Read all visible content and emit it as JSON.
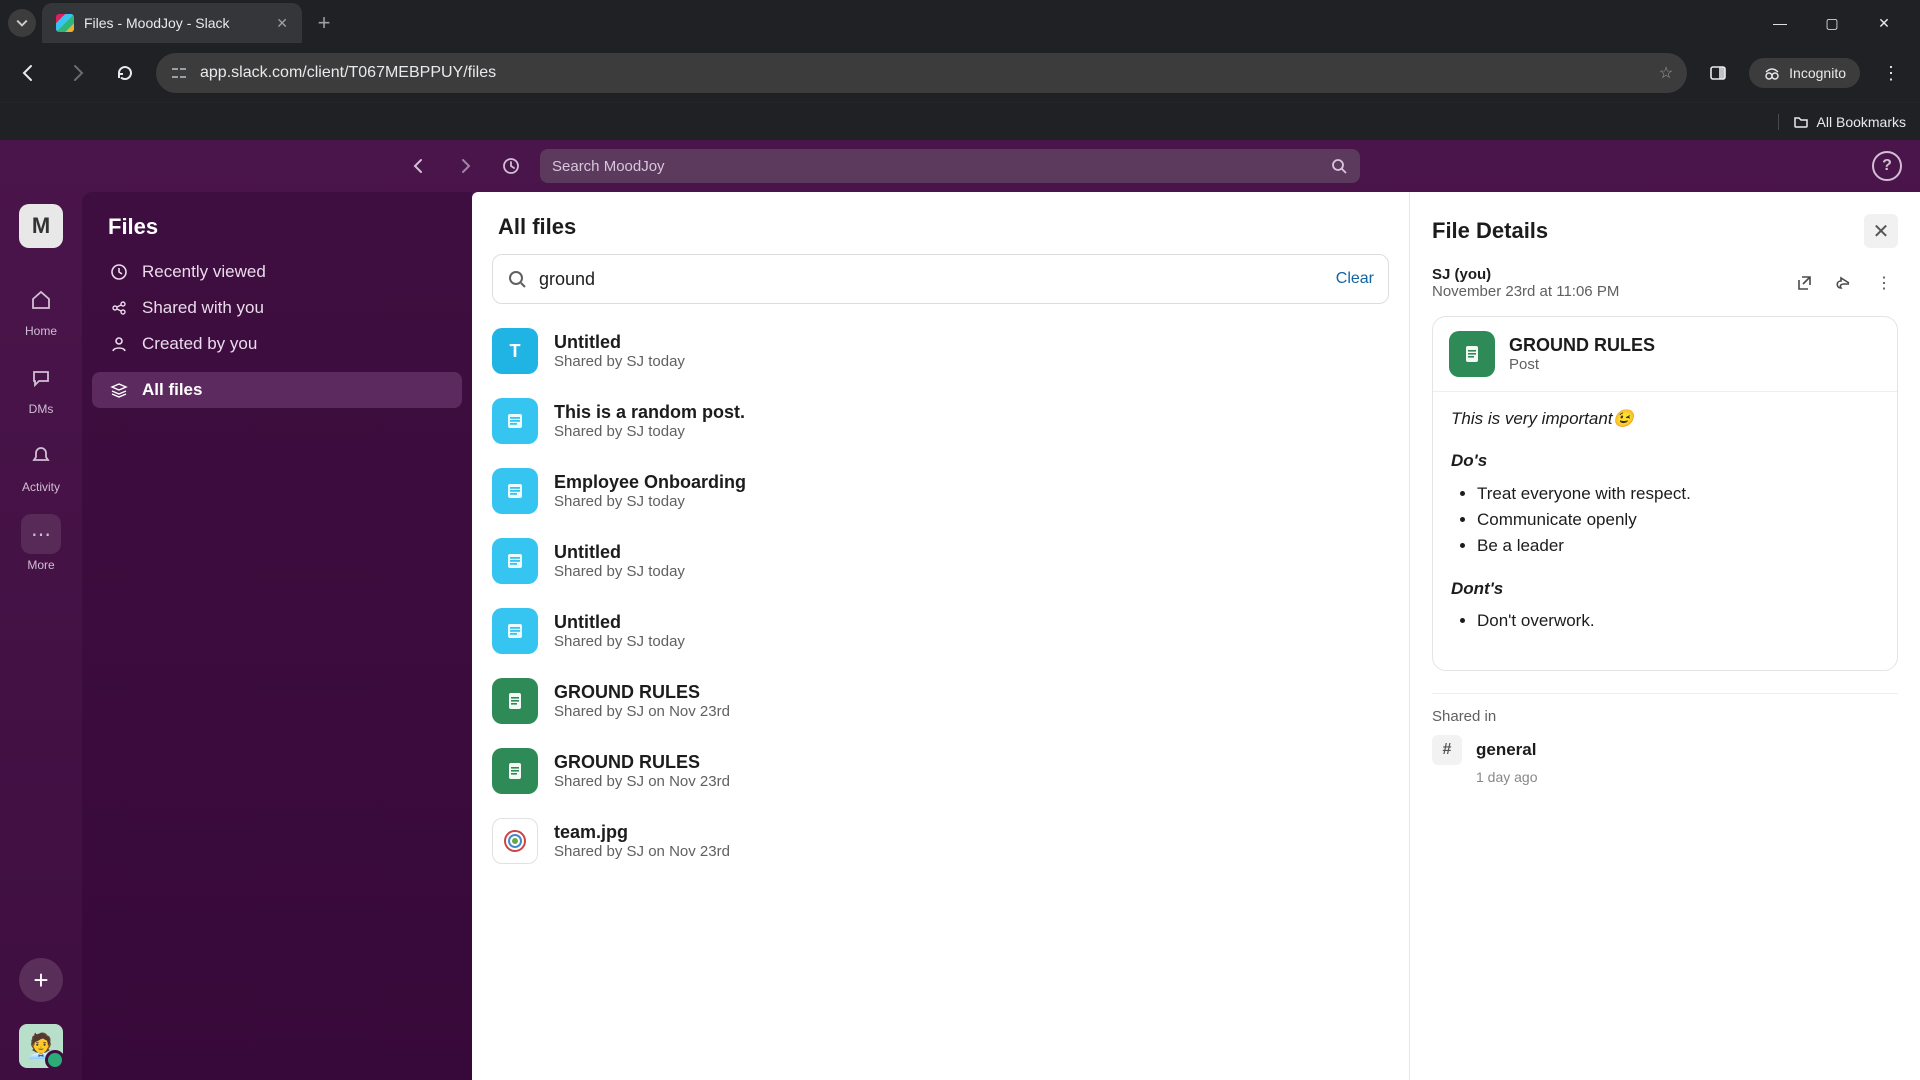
{
  "browser": {
    "tab_title": "Files - MoodJoy - Slack",
    "url": "app.slack.com/client/T067MEBPPUY/files",
    "new_tab_tooltip": "+",
    "incognito_label": "Incognito",
    "all_bookmarks": "All Bookmarks"
  },
  "slack": {
    "search_placeholder": "Search MoodJoy",
    "help_glyph": "?",
    "workspace_initial": "M",
    "rail": [
      {
        "id": "home",
        "label": "Home"
      },
      {
        "id": "dms",
        "label": "DMs"
      },
      {
        "id": "activity",
        "label": "Activity"
      },
      {
        "id": "more",
        "label": "More"
      }
    ],
    "add_label": "+"
  },
  "sidebar": {
    "title": "Files",
    "items": [
      {
        "icon": "clock",
        "label": "Recently viewed"
      },
      {
        "icon": "share",
        "label": "Shared with you"
      },
      {
        "icon": "person",
        "label": "Created by you"
      },
      {
        "icon": "stack",
        "label": "All files",
        "active": true
      }
    ]
  },
  "files": {
    "title": "All files",
    "search_value": "ground",
    "clear_label": "Clear",
    "items": [
      {
        "kind": "text",
        "title": "Untitled",
        "sub": "Shared by SJ today"
      },
      {
        "kind": "post",
        "title": "This is a random post.",
        "sub": "Shared by SJ today"
      },
      {
        "kind": "post",
        "title": "Employee Onboarding",
        "sub": "Shared by SJ today"
      },
      {
        "kind": "post",
        "title": "Untitled",
        "sub": "Shared by SJ today"
      },
      {
        "kind": "post",
        "title": "Untitled",
        "sub": "Shared by SJ today"
      },
      {
        "kind": "doc",
        "title": "GROUND RULES",
        "sub": "Shared by SJ on Nov 23rd"
      },
      {
        "kind": "doc",
        "title": "GROUND RULES",
        "sub": "Shared by SJ on Nov 23rd"
      },
      {
        "kind": "img",
        "title": "team.jpg",
        "sub": "Shared by SJ on Nov 23rd"
      }
    ]
  },
  "details": {
    "title": "File Details",
    "author": "SJ (you)",
    "when": "November 23rd at 11:06 PM",
    "doc_title": "GROUND RULES",
    "doc_type": "Post",
    "body_intro": "This is very important😉",
    "dos_header": "Do's",
    "dos": [
      "Treat everyone with respect.",
      "Communicate openly",
      "Be a leader"
    ],
    "donts_header": "Dont's",
    "donts": [
      "Don't overwork."
    ],
    "shared_in_label": "Shared in",
    "channel_name": "general",
    "channel_ago": "1 day ago"
  }
}
